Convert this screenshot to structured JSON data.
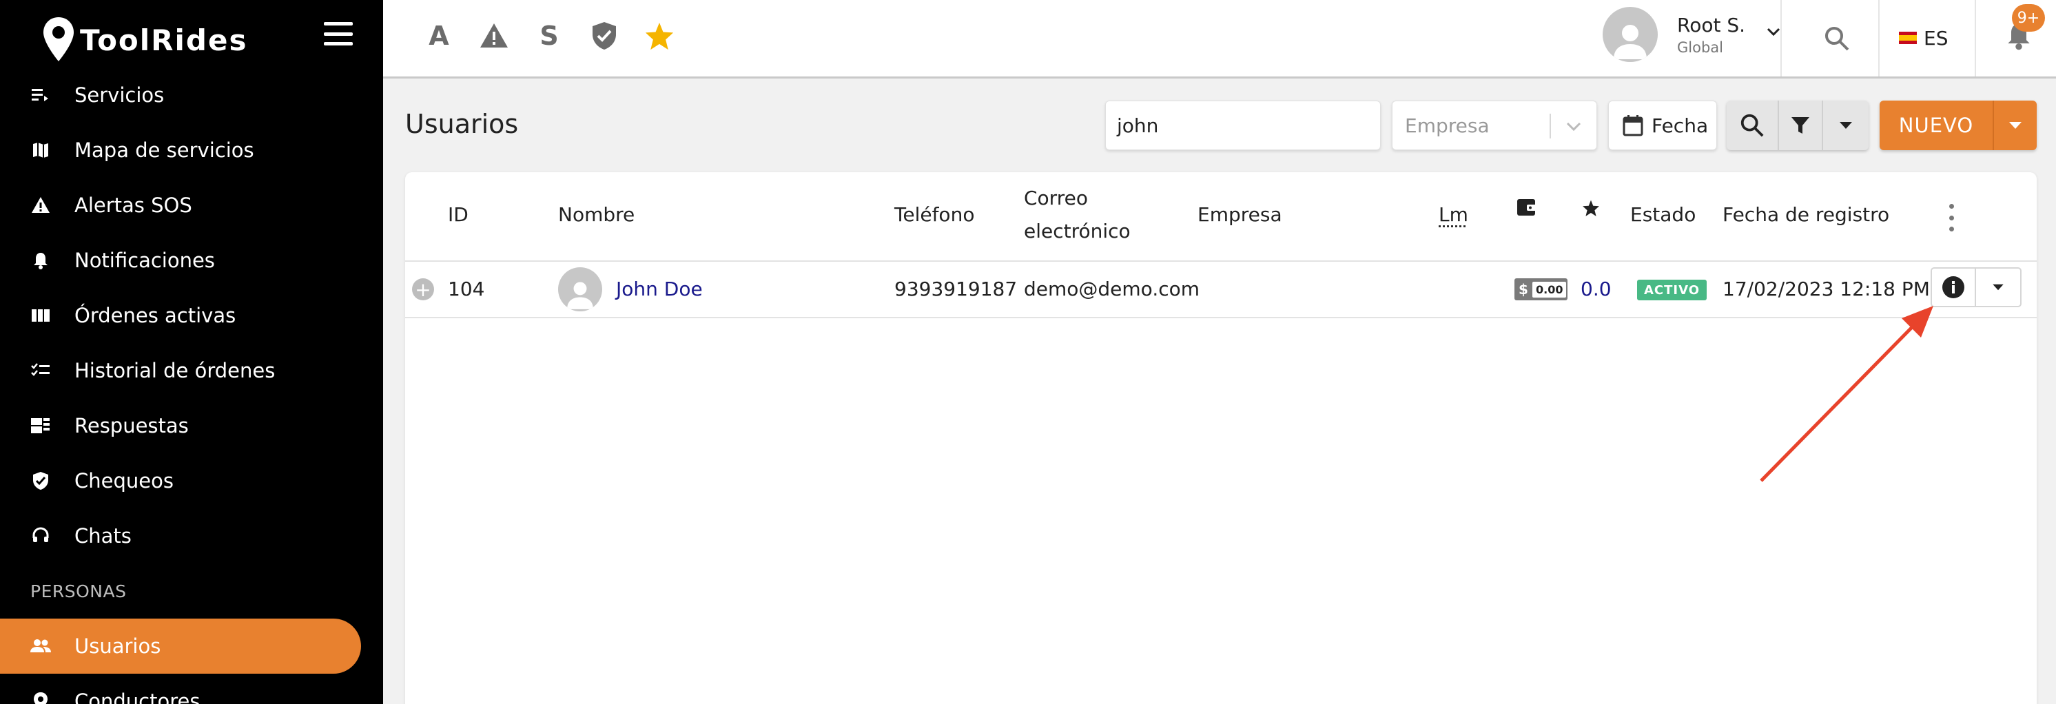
{
  "brand": {
    "name": "ToolRides"
  },
  "sidebar": {
    "items": [
      {
        "label": "Servicios",
        "icon": "list-icon"
      },
      {
        "label": "Mapa de servicios",
        "icon": "map-icon"
      },
      {
        "label": "Alertas SOS",
        "icon": "warning-icon"
      },
      {
        "label": "Notificaciones",
        "icon": "bell-icon"
      },
      {
        "label": "Órdenes activas",
        "icon": "columns-icon"
      },
      {
        "label": "Historial de órdenes",
        "icon": "checklist-icon"
      },
      {
        "label": "Respuestas",
        "icon": "responses-icon"
      },
      {
        "label": "Chequeos",
        "icon": "shield-check-icon"
      },
      {
        "label": "Chats",
        "icon": "headset-icon"
      }
    ],
    "section_label": "PERSONAS",
    "section_items": [
      {
        "label": "Usuarios",
        "icon": "people-icon",
        "active": true
      },
      {
        "label": "Conductores",
        "icon": "pin-icon"
      }
    ],
    "active_color": "#e8812f"
  },
  "topbar": {
    "quick_letters": [
      "A",
      "S"
    ],
    "user": {
      "name": "Root S.",
      "role": "Global"
    },
    "language": "ES",
    "notifications_badge": "9+"
  },
  "page": {
    "title": "Usuarios",
    "search_value": "john",
    "empresa_placeholder": "Empresa",
    "fecha_label": "Fecha",
    "new_button": "NUEVO"
  },
  "table": {
    "headers": {
      "id": "ID",
      "nombre": "Nombre",
      "telefono": "Teléfono",
      "correo_line1": "Correo",
      "correo_line2": "electrónico",
      "empresa": "Empresa",
      "lm": "Lm",
      "estado": "Estado",
      "fecha_registro": "Fecha de registro"
    },
    "rows": [
      {
        "id": "104",
        "nombre": "John Doe",
        "telefono": "9393919187",
        "correo": "demo@demo.com",
        "empresa": "",
        "wallet_symbol": "$",
        "wallet": "0.00",
        "rating": "0.0",
        "estado": "ACTIVO",
        "fecha_registro": "17/02/2023 12:18 PM"
      }
    ]
  },
  "colors": {
    "accent": "#e8812f",
    "status_active": "#48b985",
    "link": "#1a1a8c",
    "annotation_arrow": "#e8432b"
  }
}
